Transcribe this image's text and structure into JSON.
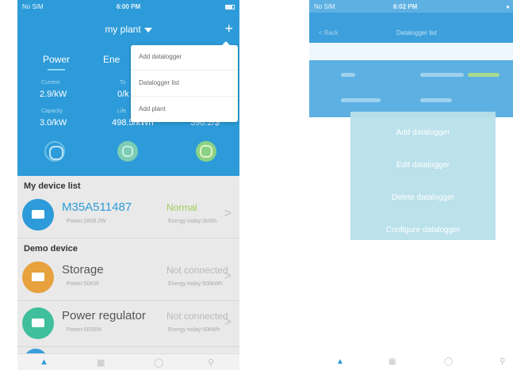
{
  "left": {
    "status": {
      "carrier": "No SIM",
      "time": "6:00 PM",
      "battery": "100%"
    },
    "header": {
      "title": "my plant",
      "plus": "+"
    },
    "tabs": {
      "power": "Power",
      "energy": "Ene"
    },
    "stats": {
      "current_label": "Current",
      "current_value": "2.9/kW",
      "today_label": "To",
      "today_value": "0/k",
      "capacity_label": "Capacity",
      "capacity_value": "3.0/kW",
      "lifetime_label": "Life",
      "lifetime_value": "498.5/kWh",
      "income_value": "398.2/$"
    },
    "dropdown": [
      "Add datalogger",
      "Datalogger list",
      "Add plant"
    ],
    "my_devices_title": "My device list",
    "my_devices": [
      {
        "name": "M35A511487",
        "power": "Power:2858.2W",
        "status": "Normal",
        "energy": "Energy today:0kWh"
      }
    ],
    "demo_title": "Demo device",
    "demo_devices": [
      {
        "name": "Storage",
        "power": "Power:50KW",
        "status": "Not connected",
        "energy": "Energy today:500kWh"
      },
      {
        "name": "Power regulator",
        "power": "Power:5000W",
        "status": "Not connected",
        "energy": "Energy today:50kWh"
      }
    ],
    "chevron": ">",
    "colors": {
      "primary": "#2d9bd9",
      "normal": "#9ccf5a",
      "storage": "#e7a13d",
      "regulator": "#3fbf9b",
      "device": "#2d9bd9"
    }
  },
  "right": {
    "status": {
      "carrier": "No SIM",
      "time": "6:02 PM",
      "battery": ""
    },
    "header": {
      "back": "< Back",
      "title": "Datalogger list"
    },
    "actions": [
      "Add datalogger",
      "Edit datalogger",
      "Delete datalogger",
      "Configure datalogger"
    ]
  },
  "icons": [
    "home-icon",
    "device-icon",
    "service-icon",
    "user-icon",
    "lightning-icon",
    "chart-icon",
    "money-icon",
    "battery-icon"
  ]
}
